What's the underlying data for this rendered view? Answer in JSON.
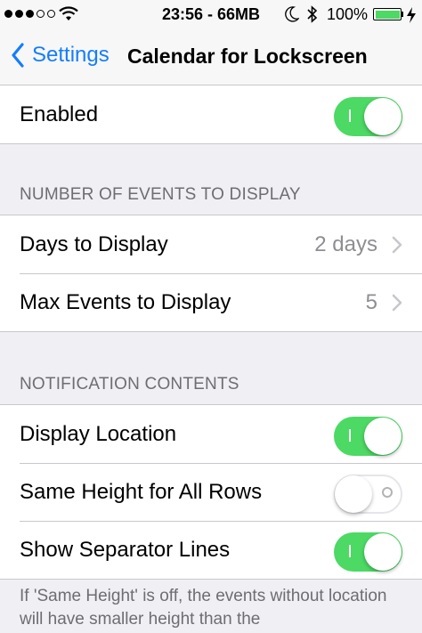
{
  "status_bar": {
    "signal_dots_filled": 3,
    "signal_dots_empty": 2,
    "time": "23:56 - 66MB",
    "battery_percent": "100%",
    "battery_level": 1.0,
    "battery_color": "#4cd964"
  },
  "nav": {
    "back_label": "Settings",
    "title": "Calendar for Lockscreen",
    "accent_color": "#147efb"
  },
  "enabled_group": {
    "label": "Enabled",
    "toggle_on": true
  },
  "events_section": {
    "header": "NUMBER OF EVENTS TO DISPLAY",
    "rows": [
      {
        "label": "Days to Display",
        "value": "2 days"
      },
      {
        "label": "Max Events to Display",
        "value": "5"
      }
    ]
  },
  "notification_section": {
    "header": "NOTIFICATION CONTENTS",
    "rows": [
      {
        "label": "Display Location",
        "toggle_on": true
      },
      {
        "label": "Same Height for All Rows",
        "toggle_on": false
      },
      {
        "label": "Show Separator Lines",
        "toggle_on": true
      }
    ],
    "footer": "If 'Same Height' is off, the events without location will have smaller height than the"
  },
  "icons": {
    "back": "chevron-left-icon",
    "disclosure": "chevron-right-icon",
    "wifi": "wifi-icon",
    "moon": "moon-icon",
    "bluetooth": "bluetooth-icon",
    "charging": "bolt-icon"
  },
  "switch_on_color": "#4cd964"
}
